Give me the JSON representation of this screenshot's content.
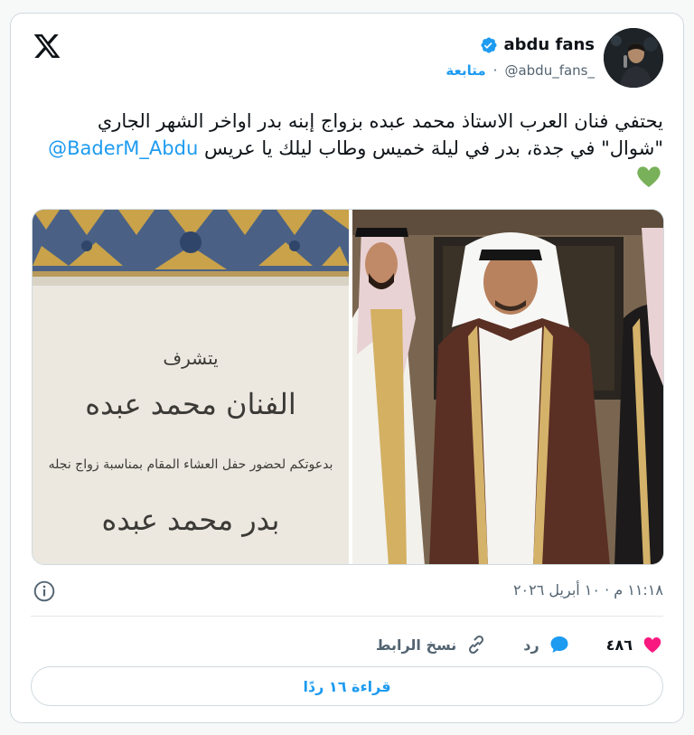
{
  "author": {
    "display_name": "abdu fans",
    "handle": "@abdu_fans_",
    "follow_label": "متابعة",
    "separator": "·"
  },
  "tweet": {
    "text_main": "يحتفي فنان العرب الاستاذ محمد عبده بزواج إبنه بدر اواخر الشهر الجاري \"شوال\" في جدة، بدر في ليلة خميس وطاب ليلك يا عريس ",
    "mention": "@BaderM_Abdu",
    "emoji": "green-heart"
  },
  "invitation": {
    "line1": "يتشرف",
    "line2": "الفنان محمد عبده",
    "line3": "بدعوتكم لحضور حفل العشاء المقام بمناسبة زواج نجله",
    "line4": "بدر محمد عبده"
  },
  "meta": {
    "timestamp": "١١:١٨ م · ١٠ أبريل ٢٠٢٦"
  },
  "actions": {
    "like_count": "٤٨٦",
    "reply_label": "رد",
    "copy_link_label": "نسخ الرابط"
  },
  "read_replies_label": "قراءة ١٦ ردًا",
  "colors": {
    "accent": "#1d9bf0",
    "like": "#f91880",
    "muted": "#536471"
  }
}
